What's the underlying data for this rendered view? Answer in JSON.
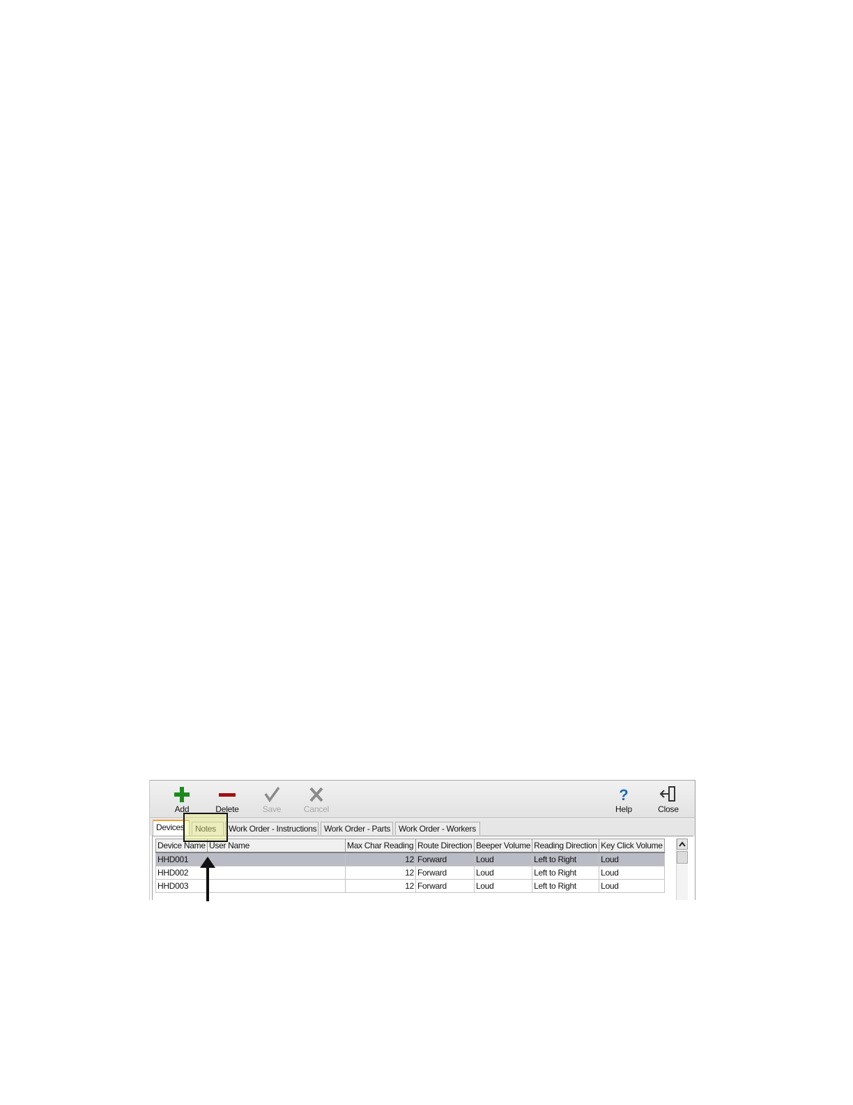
{
  "toolbar": {
    "buttons": [
      {
        "label": "Add",
        "icon": "plus-icon",
        "color": "#1e8a1e",
        "enabled": true
      },
      {
        "label": "Delete",
        "icon": "minus-icon",
        "color": "#a01010",
        "enabled": true
      },
      {
        "label": "Save",
        "icon": "check-icon",
        "enabled": false
      },
      {
        "label": "Cancel",
        "icon": "x-icon",
        "enabled": false
      },
      {
        "label": "Help",
        "icon": "help-icon",
        "color": "#1a6ab4",
        "enabled": true
      },
      {
        "label": "Close",
        "icon": "exit-door-icon",
        "enabled": true
      }
    ]
  },
  "tabs": [
    {
      "label": "Devices",
      "active": true
    },
    {
      "label": "Notes",
      "active": false
    },
    {
      "label": "Work Order - Instructions",
      "active": false
    },
    {
      "label": "Work Order - Parts",
      "active": false
    },
    {
      "label": "Work Order - Workers",
      "active": false
    }
  ],
  "grid": {
    "columns": [
      "Device Name",
      "User Name",
      "Max Char Reading",
      "Route Direction",
      "Beeper Volume",
      "Reading Direction",
      "Key Click Volume"
    ],
    "rows": [
      [
        "HHD001",
        "",
        "12",
        "Forward",
        "Loud",
        "Left to Right",
        "Loud"
      ],
      [
        "HHD002",
        "",
        "12",
        "Forward",
        "Loud",
        "Left to Right",
        "Loud"
      ],
      [
        "HHD003",
        "",
        "12",
        "Forward",
        "Loud",
        "Left to Right",
        "Loud"
      ]
    ],
    "selected_row": 0
  },
  "annotation": {
    "highlight_color": "#ebf082",
    "target": "Notes"
  }
}
